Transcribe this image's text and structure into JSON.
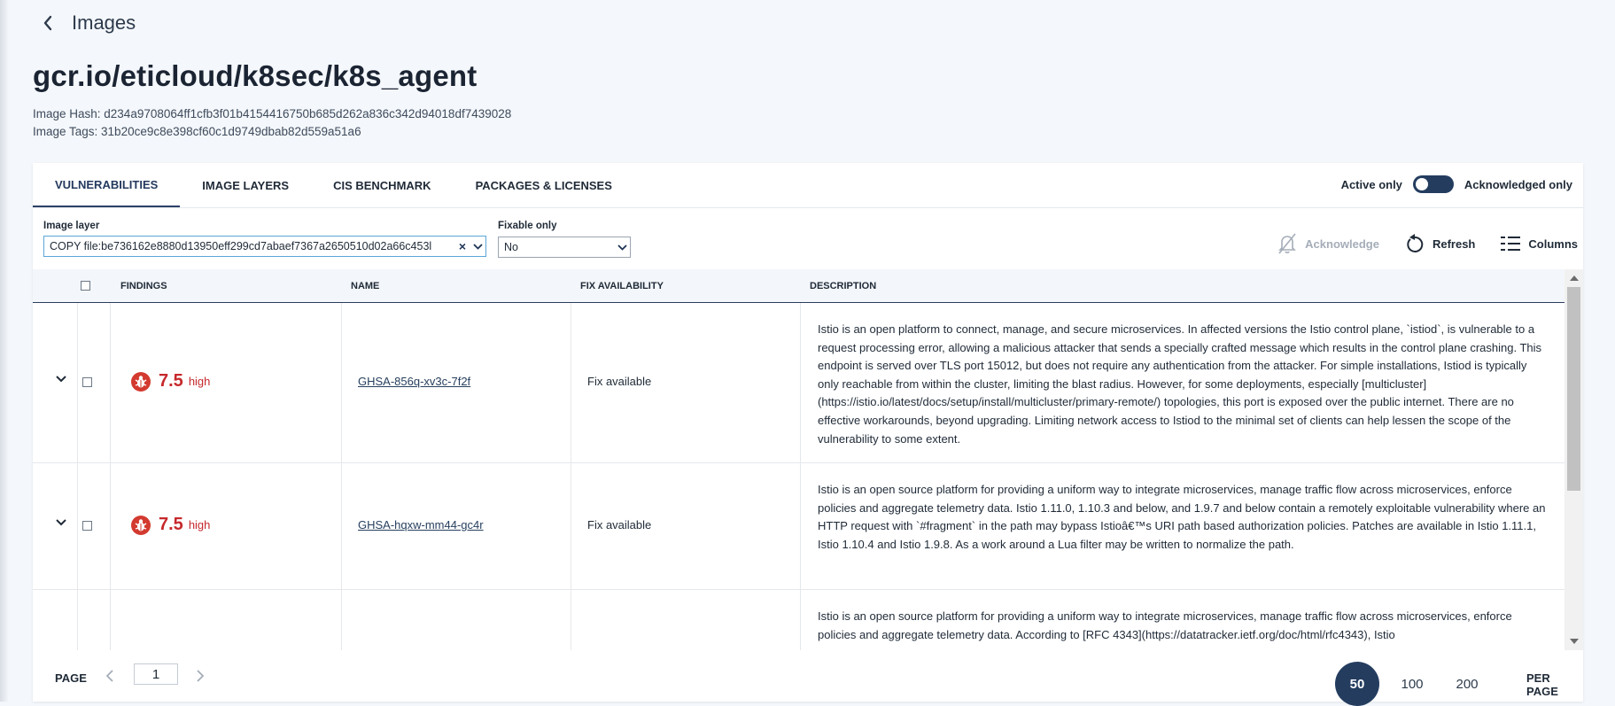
{
  "header": {
    "back_label": "Images",
    "title": "gcr.io/eticloud/k8sec/k8s_agent",
    "hash_line": "Image Hash: d234a9708064ff1cfb3f01b4154416750b685d262a836c342d94018df7439028",
    "tags_line": "Image Tags: 31b20ce9c8e398cf60c1d9749dbab82d559a51a6"
  },
  "tabs": [
    {
      "label": "VULNERABILITIES",
      "active": true
    },
    {
      "label": "IMAGE LAYERS"
    },
    {
      "label": "CIS BENCHMARK"
    },
    {
      "label": "PACKAGES & LICENSES"
    }
  ],
  "toggle": {
    "left_label": "Active only",
    "right_label": "Acknowledged only"
  },
  "filters": {
    "image_layer_label": "Image layer",
    "image_layer_value": "COPY file:be736162e8880d13950eff299cd7abaef7367a2650510d02a66c453l",
    "fixable_label": "Fixable only",
    "fixable_value": "No"
  },
  "actions": {
    "acknowledge": "Acknowledge",
    "refresh": "Refresh",
    "columns": "Columns"
  },
  "table": {
    "headers": {
      "findings": "FINDINGS",
      "name": "NAME",
      "fix": "FIX AVAILABILITY",
      "description": "DESCRIPTION"
    },
    "rows": [
      {
        "score": "7.5",
        "severity": "high",
        "name": "GHSA-856q-xv3c-7f2f",
        "fix": "Fix available",
        "description": "Istio is an open platform to connect, manage, and secure microservices. In affected versions the Istio control plane, `istiod`, is vulnerable to a request processing error, allowing a malicious attacker that sends a specially crafted message which results in the control plane crashing. This endpoint is served over TLS port 15012, but does not require any authentication from the attacker. For simple installations, Istiod is typically only reachable from within the cluster, limiting the blast radius. However, for some deployments, especially [multicluster](https://istio.io/latest/docs/setup/install/multicluster/primary-remote/) topologies, this port is exposed over the public internet. There are no effective workarounds, beyond upgrading. Limiting network access to Istiod to the minimal set of clients can help lessen the scope of the vulnerability to some extent."
      },
      {
        "score": "7.5",
        "severity": "high",
        "name": "GHSA-hqxw-mm44-gc4r",
        "fix": "Fix available",
        "description": "Istio is an open source platform for providing a uniform way to integrate microservices, manage traffic flow across microservices, enforce policies and aggregate telemetry data. Istio 1.11.0, 1.10.3 and below, and 1.9.7 and below contain a remotely exploitable vulnerability where an HTTP request with `#fragment` in the path may bypass Istioâ€™s URI path based authorization policies. Patches are available in Istio 1.11.1, Istio 1.10.4 and Istio 1.9.8. As a work around a Lua filter may be written to normalize the path."
      },
      {
        "description": "Istio is an open source platform for providing a uniform way to integrate microservices, manage traffic flow across microservices, enforce policies and aggregate telemetry data. According to [RFC 4343](https://datatracker.ietf.org/doc/html/rfc4343), Istio"
      }
    ]
  },
  "pagination": {
    "page_label": "PAGE",
    "current_page": "1",
    "per_page_options": [
      "50",
      "100",
      "200"
    ],
    "per_page_selected": "50",
    "per_page_label": "PER PAGE"
  }
}
